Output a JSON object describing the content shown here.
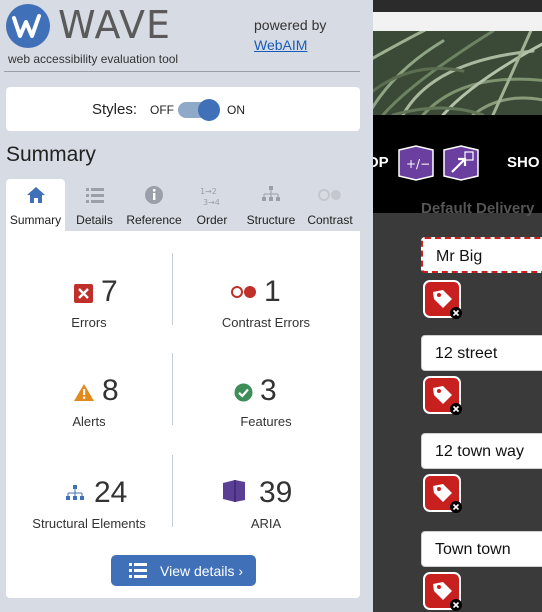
{
  "wave": {
    "title": "WAVE",
    "subtitle": "web accessibility evaluation tool",
    "powered_by": "powered by",
    "webaim": "WebAIM",
    "styles": {
      "label": "Styles:",
      "off": "OFF",
      "on": "ON",
      "state": "on"
    },
    "summary_heading": "Summary",
    "tabs": [
      {
        "label": "Summary",
        "icon": "home-icon",
        "active": true
      },
      {
        "label": "Details",
        "icon": "list-icon"
      },
      {
        "label": "Reference",
        "icon": "info-icon"
      },
      {
        "label": "Order",
        "icon": "order-icon"
      },
      {
        "label": "Structure",
        "icon": "structure-icon"
      },
      {
        "label": "Contrast",
        "icon": "contrast-icon"
      }
    ],
    "stats": {
      "errors": {
        "count": "7",
        "label": "Errors",
        "color": "#c0302b"
      },
      "contrast": {
        "count": "1",
        "label": "Contrast Errors",
        "color": "#c0302b"
      },
      "alerts": {
        "count": "8",
        "label": "Alerts",
        "color": "#e08a1e"
      },
      "features": {
        "count": "3",
        "label": "Features",
        "color": "#3e8e5a"
      },
      "structural": {
        "count": "24",
        "label": "Structural Elements",
        "color": "#3f70b8"
      },
      "aria": {
        "count": "39",
        "label": "ARIA",
        "color": "#5b3e96"
      }
    },
    "view_details": "View details ›",
    "accent": "#3f70b8"
  },
  "page": {
    "nav_left": "OP",
    "nav_right": "SHO",
    "subheading": "Default Delivery",
    "fields": [
      "Mr Big",
      "12 street",
      "12 town way",
      "Town town"
    ]
  }
}
